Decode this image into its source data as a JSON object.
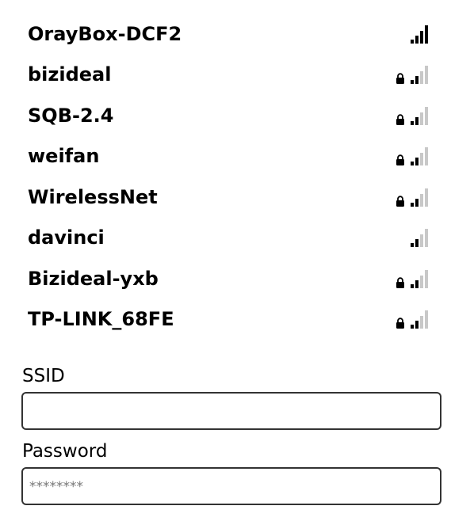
{
  "networks": [
    {
      "ssid": "OrayBox-DCF2",
      "locked": false,
      "signal": 4
    },
    {
      "ssid": "bizideal",
      "locked": true,
      "signal": 2
    },
    {
      "ssid": "SQB-2.4",
      "locked": true,
      "signal": 2
    },
    {
      "ssid": "weifan",
      "locked": true,
      "signal": 2
    },
    {
      "ssid": "WirelessNet",
      "locked": true,
      "signal": 2
    },
    {
      "ssid": "davinci",
      "locked": false,
      "signal": 2
    },
    {
      "ssid": "Bizideal-yxb",
      "locked": true,
      "signal": 2
    },
    {
      "ssid": "TP-LINK_68FE",
      "locked": true,
      "signal": 2
    }
  ],
  "form": {
    "ssid_label": "SSID",
    "ssid_value": "",
    "password_label": "Password",
    "password_placeholder": "********",
    "password_value": ""
  },
  "colors": {
    "signal_on": "#000000",
    "signal_off": "#c8c8c8",
    "input_border": "#333333"
  },
  "icons": {
    "lock": "lock-icon",
    "signal": "signal-strength-icon"
  }
}
